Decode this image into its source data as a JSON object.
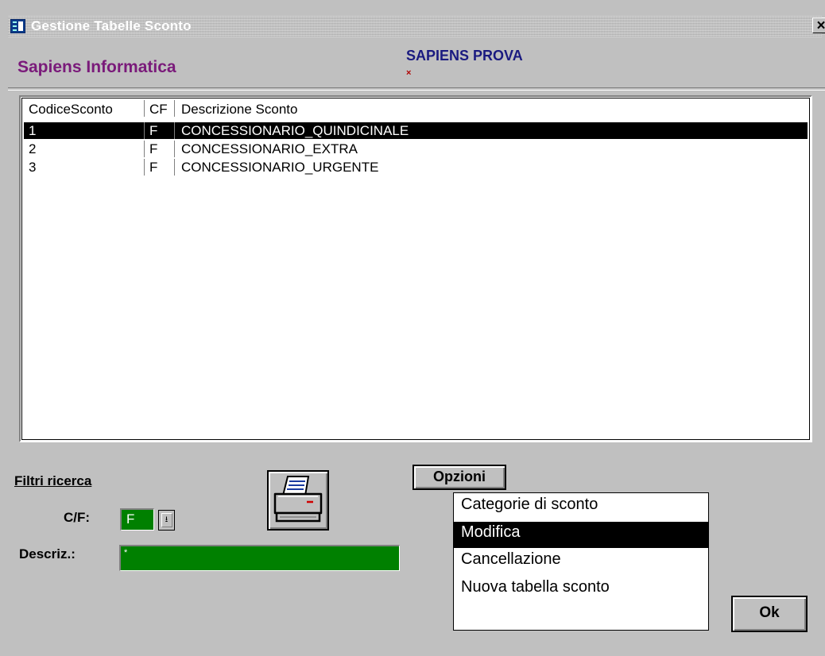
{
  "window": {
    "title": "Gestione Tabelle Sconto",
    "close_label": "×",
    "icon": "form-icon"
  },
  "header": {
    "company": "Sapiens Informatica",
    "database": "SAPIENS PROVA",
    "database_mark": "×"
  },
  "table": {
    "columns": [
      "CodiceSconto",
      "CF",
      "Descrizione Sconto"
    ],
    "rows": [
      {
        "code": "1",
        "cf": "F",
        "description": "CONCESSIONARIO_QUINDICINALE"
      },
      {
        "code": "2",
        "cf": "F",
        "description": "CONCESSIONARIO_EXTRA"
      },
      {
        "code": "3",
        "cf": "F",
        "description": "CONCESSIONARIO_URGENTE"
      }
    ],
    "selected_row": 0
  },
  "filters": {
    "heading": "Filtri ricerca",
    "cf_label": "C/F:",
    "cf_value": "F",
    "desc_label": "Descriz.:",
    "desc_value": "*"
  },
  "actions": {
    "print_icon": "printer-icon",
    "options_label": "Opzioni",
    "options": [
      "Categorie di sconto",
      "Modifica",
      "Cancellazione",
      "Nuova tabella sconto"
    ],
    "selected_option": 1,
    "ok_label": "Ok"
  },
  "colors": {
    "field_bg": "#008000",
    "company": "#7a1a7a",
    "database": "#1a1a80",
    "selection": "#000000"
  }
}
